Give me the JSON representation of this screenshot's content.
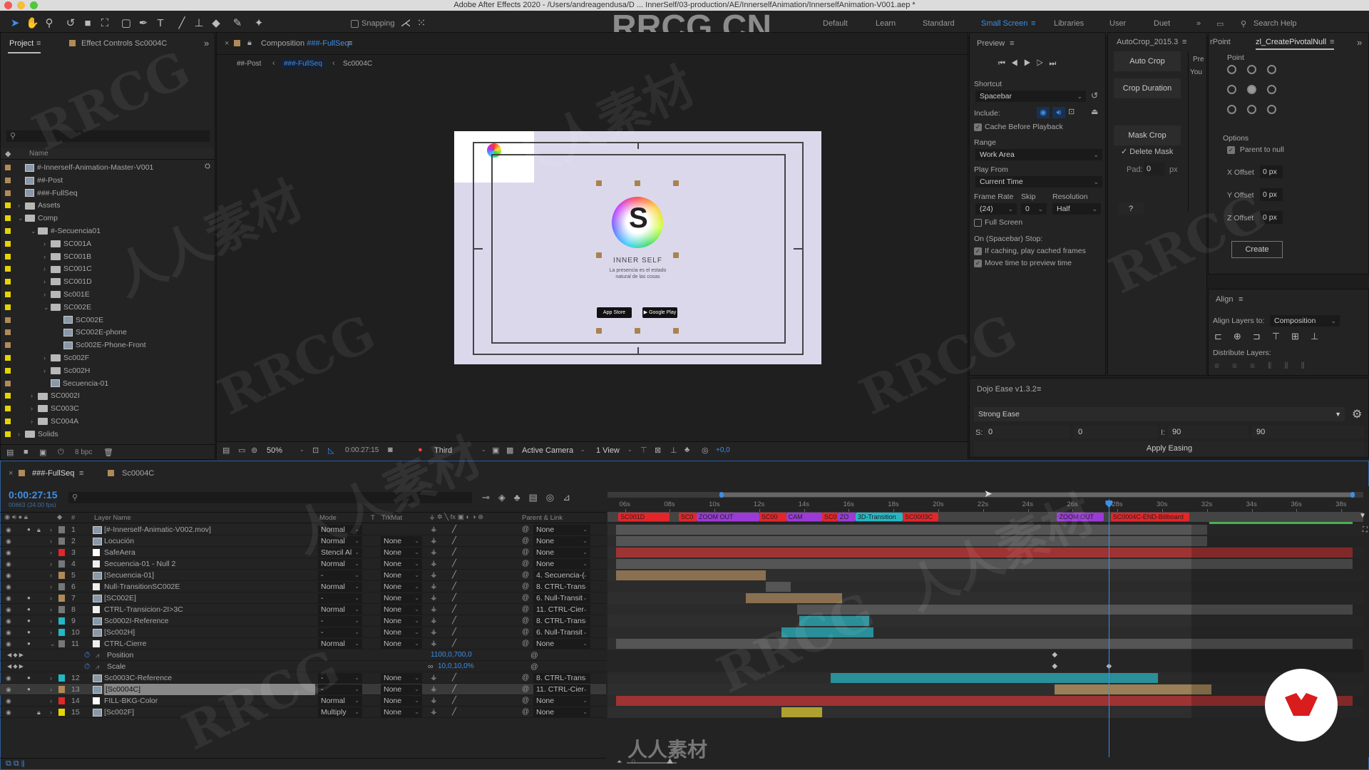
{
  "title_bar": {
    "text": "Adobe After Effects 2020 - /Users/andreagendusa/D ... InnerSelf/03-production/AE/InnerselfAnimation/InnerselfAnimation-V001.aep *"
  },
  "toolbar": {
    "snapping_label": "Snapping",
    "watermark": "RRCG.CN",
    "workspaces": [
      "Default",
      "Learn",
      "Standard",
      "Small Screen",
      "Libraries",
      "User",
      "Duet"
    ],
    "active_workspace": "Small Screen",
    "search_help": "Search Help",
    "accent": "#3d8ee8"
  },
  "project_panel": {
    "tab_project": "Project",
    "tab_effect_controls": "Effect Controls Sc0004C",
    "column_name": "Name",
    "bpc": "8 bpc",
    "items": [
      {
        "name": "#-Innerself-Animation-Master-V001",
        "type": "comp",
        "indent": 0,
        "label": "#b08a58"
      },
      {
        "name": "##-Post",
        "type": "comp",
        "indent": 0,
        "label": "#b08a58"
      },
      {
        "name": "###-FullSeq",
        "type": "comp",
        "indent": 0,
        "label": "#b08a58"
      },
      {
        "name": "Assets",
        "type": "folder",
        "indent": 0,
        "label": "#e6d400",
        "open": false
      },
      {
        "name": "Comp",
        "type": "folder",
        "indent": 0,
        "label": "#e6d400",
        "open": true
      },
      {
        "name": "#-Secuencia01",
        "type": "folder",
        "indent": 1,
        "label": "#e6d400",
        "open": true
      },
      {
        "name": "SC001A",
        "type": "folder",
        "indent": 2,
        "label": "#e6d400",
        "open": false
      },
      {
        "name": "SC001B",
        "type": "folder",
        "indent": 2,
        "label": "#e6d400",
        "open": false
      },
      {
        "name": "SC001C",
        "type": "folder",
        "indent": 2,
        "label": "#e6d400",
        "open": false
      },
      {
        "name": "SC001D",
        "type": "folder",
        "indent": 2,
        "label": "#e6d400",
        "open": false
      },
      {
        "name": "Sc001E",
        "type": "folder",
        "indent": 2,
        "label": "#e6d400",
        "open": false
      },
      {
        "name": "SC002E",
        "type": "folder",
        "indent": 2,
        "label": "#e6d400",
        "open": true
      },
      {
        "name": "SC002E",
        "type": "comp",
        "indent": 3,
        "label": "#b08a58"
      },
      {
        "name": "SC002E-phone",
        "type": "comp",
        "indent": 3,
        "label": "#b08a58"
      },
      {
        "name": "Sc002E-Phone-Front",
        "type": "comp",
        "indent": 3,
        "label": "#b08a58"
      },
      {
        "name": "Sc002F",
        "type": "folder",
        "indent": 2,
        "label": "#e6d400",
        "open": false
      },
      {
        "name": "Sc002H",
        "type": "folder",
        "indent": 2,
        "label": "#e6d400",
        "open": false
      },
      {
        "name": "Secuencia-01",
        "type": "comp",
        "indent": 2,
        "label": "#b08a58"
      },
      {
        "name": "SC0002I",
        "type": "folder",
        "indent": 1,
        "label": "#e6d400",
        "open": false
      },
      {
        "name": "SC003C",
        "type": "folder",
        "indent": 1,
        "label": "#e6d400",
        "open": false
      },
      {
        "name": "SC004A",
        "type": "folder",
        "indent": 1,
        "label": "#e6d400",
        "open": false
      },
      {
        "name": "Solids",
        "type": "folder",
        "indent": 0,
        "label": "#e6d400",
        "open": false
      }
    ]
  },
  "composition": {
    "tab_label": "Composition",
    "tab_comp": "###-FullSeq",
    "breadcrumbs": [
      "##-Post",
      "###-FullSeq",
      "Sc0004C"
    ],
    "active_breadcrumb": "###-FullSeq",
    "viewer": {
      "brand": "INNER SELF",
      "tagline_1": "La presencia es el estado",
      "tagline_2": "natural de las cosas",
      "app_store": "App Store",
      "google_play": "Google Play",
      "bg_color": "#dcd8ec"
    },
    "footer": {
      "zoom": "50%",
      "timecode": "0:00:27:15",
      "resolution": "Third",
      "camera": "Active Camera",
      "views": "1 View",
      "exposure": "+0,0"
    }
  },
  "preview_panel": {
    "title": "Preview",
    "shortcut_label": "Shortcut",
    "shortcut_value": "Spacebar",
    "include_label": "Include:",
    "cache_before_playback": {
      "label": "Cache Before Playback",
      "checked": true
    },
    "range_label": "Range",
    "range_value": "Work Area",
    "play_from_label": "Play From",
    "play_from_value": "Current Time",
    "frame_rate_label": "Frame Rate",
    "skip_label": "Skip",
    "resolution_label": "Resolution",
    "frame_rate_value": "(24)",
    "skip_value": "0",
    "resolution_value": "Half",
    "full_screen": {
      "label": "Full Screen",
      "checked": false
    },
    "on_stop_label": "On (Spacebar) Stop:",
    "if_caching": {
      "label": "If caching, play cached frames",
      "checked": true
    },
    "move_time": {
      "label": "Move time to preview time",
      "checked": true
    }
  },
  "autocrop_panel": {
    "title": "AutoCrop_2015.3",
    "auto_crop": "Auto Crop",
    "crop_duration": "Crop Duration",
    "mask_crop": "Mask Crop",
    "delete_mask": "Delete Mask",
    "pad_label": "Pad:",
    "pad_value": "0",
    "pad_unit": "px",
    "help": "?",
    "side_text_1": "Pre",
    "side_text_2": "You"
  },
  "pivotal_null_panel": {
    "tab_prev": "rPoint",
    "title": "zl_CreatePivotalNull",
    "point_label": "Point",
    "selected_point": 4,
    "options_label": "Options",
    "parent_to_null": {
      "label": "Parent to null",
      "checked": true
    },
    "x_offset_label": "X Offset",
    "x_offset": "0 px",
    "y_offset_label": "Y Offset",
    "y_offset": "0 px",
    "z_offset_label": "Z Offset",
    "z_offset": "0 px",
    "create": "Create"
  },
  "align_panel": {
    "title": "Align",
    "align_to_label": "Align Layers to:",
    "align_to_value": "Composition",
    "distribute_label": "Distribute Layers:"
  },
  "dojo_panel": {
    "title": "Dojo Ease v1.3.2",
    "preset": "Strong Ease",
    "s_label": "S:",
    "s_value_1": "0",
    "s_value_2": "0",
    "i_label": "I:",
    "i_value_1": "90",
    "i_value_2": "90",
    "apply": "Apply Easing"
  },
  "timeline": {
    "tab_active": "###-FullSeq",
    "tab_other": "Sc0004C",
    "current_time": "0:00:27:15",
    "frame_info": "00663 (24.00 fps)",
    "columns": {
      "layer_name": "Layer Name",
      "mode": "Mode",
      "t": "T",
      "trkmat": "TrkMat",
      "parent": "Parent & Link"
    },
    "ruler_ticks": [
      "06s",
      "08s",
      "10s",
      "12s",
      "14s",
      "16s",
      "18s",
      "20s",
      "22s",
      "24s",
      "26s",
      "28s",
      "30s",
      "32s",
      "34s",
      "36s",
      "38s"
    ],
    "ruler_start_sec": 5.6,
    "ruler_end_sec": 38.6,
    "playhead_sec": 27.625,
    "work_area_sec": [
      10.3,
      38.5
    ],
    "markers": [
      {
        "label": "SC001D",
        "start": 5.7,
        "end": 8.0,
        "color": "#e3262a"
      },
      {
        "label": "SC0",
        "start": 8.4,
        "end": 9.2,
        "color": "#e3262a"
      },
      {
        "label": "ZOOM OUT",
        "start": 9.2,
        "end": 12.0,
        "color": "#9b3ad6"
      },
      {
        "label": "SC00",
        "start": 12.0,
        "end": 13.2,
        "color": "#e3262a"
      },
      {
        "label": "CAM",
        "start": 13.2,
        "end": 14.8,
        "color": "#9b3ad6"
      },
      {
        "label": "SC0",
        "start": 14.8,
        "end": 15.5,
        "color": "#e3262a"
      },
      {
        "label": "ZO",
        "start": 15.5,
        "end": 16.3,
        "color": "#9b3ad6"
      },
      {
        "label": "3D-Transition",
        "start": 16.3,
        "end": 18.4,
        "color": "#25b7c4"
      },
      {
        "label": "SC0003C",
        "start": 18.4,
        "end": 20.0,
        "color": "#e3262a"
      },
      {
        "label": "ZOOM OUT",
        "start": 25.3,
        "end": 27.4,
        "color": "#9b3ad6"
      },
      {
        "label": "SC0004C-END-Billboard",
        "start": 27.7,
        "end": 31.2,
        "color": "#e3262a"
      }
    ],
    "layers": [
      {
        "num": "1",
        "name": "[#-Innerself-Animatic-V002.mov]",
        "label": "#777777",
        "mode": "Normal",
        "trkmat": "",
        "parent": "None",
        "type": "footage",
        "bar": {
          "start": 5.6,
          "end": 32.0,
          "color": "#555555"
        }
      },
      {
        "num": "2",
        "name": "Locución",
        "label": "#777777",
        "mode": "Normal",
        "trkmat": "None",
        "parent": "None",
        "type": "comp",
        "bar": {
          "start": 5.6,
          "end": 32.0,
          "color": "#555555"
        }
      },
      {
        "num": "3",
        "name": "SafeAera",
        "label": "#e3262a",
        "mode": "Stencil Al",
        "trkmat": "None",
        "parent": "None",
        "type": "solid",
        "bar": {
          "start": 5.6,
          "end": 38.5,
          "color": "#9e3333"
        }
      },
      {
        "num": "4",
        "name": "Secuencia-01 - Null 2",
        "label": "#777777",
        "mode": "Normal",
        "trkmat": "None",
        "parent": "None",
        "type": "null",
        "bar": {
          "start": 5.6,
          "end": 38.5,
          "color": "#555555"
        }
      },
      {
        "num": "5",
        "name": "[Secuencia-01]",
        "label": "#b08a58",
        "mode": "-",
        "trkmat": "None",
        "parent": "4. Secuencia-(",
        "type": "comp",
        "bar": {
          "start": 5.6,
          "end": 12.3,
          "color": "#8a7050"
        }
      },
      {
        "num": "6",
        "name": "Null-TransitionSC002E",
        "label": "#777777",
        "mode": "Normal",
        "trkmat": "None",
        "parent": "8. CTRL-Trans",
        "type": "null",
        "bar": {
          "start": 12.3,
          "end": 13.4,
          "color": "#555555"
        }
      },
      {
        "num": "7",
        "name": "[SC002E]",
        "label": "#b08a58",
        "mode": "-",
        "trkmat": "None",
        "parent": "6. Null-Transit",
        "type": "comp",
        "bar": {
          "start": 11.4,
          "end": 15.7,
          "color": "#8a7050"
        }
      },
      {
        "num": "8",
        "name": "CTRL-Transicion-2I>3C",
        "label": "#777777",
        "mode": "Normal",
        "trkmat": "None",
        "parent": "11. CTRL-Cier",
        "type": "null",
        "bar": {
          "start": 13.7,
          "end": 38.5,
          "color": "#555555"
        }
      },
      {
        "num": "9",
        "name": "Sc0002I-Reference",
        "label": "#25b7c4",
        "mode": "-",
        "trkmat": "None",
        "parent": "8. CTRL-Trans",
        "type": "comp",
        "bar": {
          "start": 13.8,
          "end": 16.9,
          "color": "#2a8f98"
        }
      },
      {
        "num": "10",
        "name": "[Sc002H]",
        "label": "#25b7c4",
        "mode": "-",
        "trkmat": "None",
        "parent": "6. Null-Transit",
        "type": "comp",
        "bar": {
          "start": 13.0,
          "end": 17.1,
          "color": "#2a8f98"
        }
      },
      {
        "num": "11",
        "name": "CTRL-Cierre",
        "label": "#777777",
        "mode": "Normal",
        "trkmat": "None",
        "parent": "None",
        "type": "null",
        "open": true,
        "bar": {
          "start": 5.6,
          "end": 38.5,
          "color": "#555555"
        }
      },
      {
        "num": "12",
        "name": "Sc0003C-Reference",
        "label": "#25b7c4",
        "mode": "-",
        "trkmat": "None",
        "parent": "8. CTRL-Trans",
        "type": "comp",
        "bar": {
          "start": 15.2,
          "end": 29.8,
          "color": "#2a8f98"
        }
      },
      {
        "num": "13",
        "name": "[Sc0004C]",
        "label": "#b08a58",
        "mode": "-",
        "trkmat": "None",
        "parent": "11. CTRL-Cier",
        "type": "comp",
        "selected": true,
        "bar": {
          "start": 25.2,
          "end": 32.2,
          "color": "#9b7f56"
        }
      },
      {
        "num": "14",
        "name": "FILL-BKG-Color",
        "label": "#e3262a",
        "mode": "Normal",
        "trkmat": "None",
        "parent": "None",
        "type": "solid",
        "bar": {
          "start": 5.6,
          "end": 38.5,
          "color": "#9e3333"
        }
      },
      {
        "num": "15",
        "name": "[Sc002F]",
        "label": "#e6d400",
        "mode": "Multiply",
        "trkmat": "None",
        "parent": "None",
        "type": "comp",
        "locked": true,
        "bar": {
          "start": 13.0,
          "end": 14.8,
          "color": "#b0a030"
        }
      }
    ],
    "properties": [
      {
        "name": "Position",
        "value": "1100,0,700,0",
        "keyframes_sec": [
          25.2
        ]
      },
      {
        "name": "Scale",
        "value": "10,0,10,0%",
        "keyframes_sec": [
          25.2,
          27.625
        ]
      }
    ]
  },
  "watermarks": [
    "RRCG",
    "人人素材"
  ]
}
